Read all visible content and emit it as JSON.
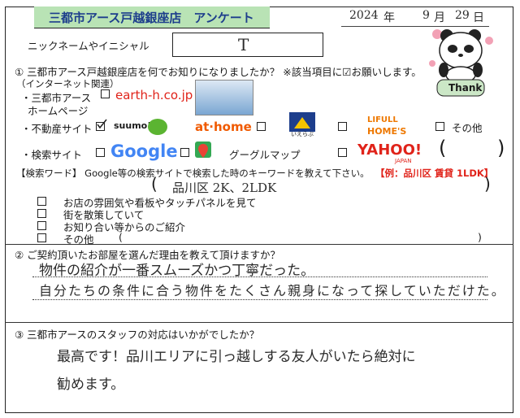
{
  "header": {
    "title": "三都市アース戸越銀座店　アンケート",
    "date": {
      "year": "2024",
      "nen": "年",
      "month": "9",
      "tsuki": "月",
      "day": "29",
      "nichi": "日"
    }
  },
  "nickname": {
    "label": "ニックネームやイニシャル",
    "value": "T"
  },
  "thank_label": "Thank",
  "q1": {
    "question": "① 三都市アース戸越銀座店を何でお知りになりましたか？ ※該当項目に☑お願いします。",
    "internet_label": "（インターネット関連）",
    "homepage_label_1": "・三都市アース",
    "homepage_label_2": "ホームページ",
    "homepage_url": "earth-h.co.jp",
    "realestate_label": "・不動産サイト",
    "suumo_logo": "suumo!",
    "athome_logo": "at·home",
    "ieshiru_logo": "いえらぶ",
    "lifull_logo_1": "LIFULL",
    "lifull_logo_2": "HOME'S",
    "other_label": "その他",
    "search_label": "・検索サイト",
    "google_logo": "Google",
    "googlemap_label": "グーグルマップ",
    "yahoo_logo": "YAHOO!",
    "yahoo_sub": "JAPAN",
    "other_paren_open": "(",
    "other_paren_close": ")",
    "keyword_label": "【検索ワード】 Google等の検索サイトで検索した時のキーワードを教えて下さい。",
    "keyword_example": "【例：品川区 賃貸 1LDK】",
    "keyword_answer": "品川区 2K、2LDK",
    "keyword_paren_open": "(",
    "keyword_paren_close": ")",
    "offline_options": [
      "お店の雰囲気や看板やタッチパネルを見て",
      "街を散策していて",
      "お知り合い等からのご紹介",
      "その他"
    ],
    "offline_other_open": "(",
    "offline_other_close": ")"
  },
  "q2": {
    "question": "② ご契約頂いたお部屋を選んだ理由を教えて頂けますか？",
    "answer_line1": "物件の紹介が一番スムーズかつ丁寧だった。",
    "answer_line2": "自分たちの条件に合う物件をたくさん親身になって探していただけた。"
  },
  "q3": {
    "question": "③ 三都市アースのスタッフの対応はいかがでしたか？",
    "answer_line1": "最高です！品川エリアに引っ越しする友人がいたら絶対に",
    "answer_line2": "勧めます。"
  },
  "colors": {
    "header_bg": "#b9e3b5",
    "header_text": "#1d3e8c",
    "highlight_red": "#e0231a",
    "athome_orange": "#f05a00",
    "lifull_orange": "#ee7800",
    "suumo_green": "#5bb431"
  },
  "icons": [
    "panda-icon",
    "flower-icon",
    "checkmark-icon",
    "house-icon",
    "map-pin-icon"
  ]
}
